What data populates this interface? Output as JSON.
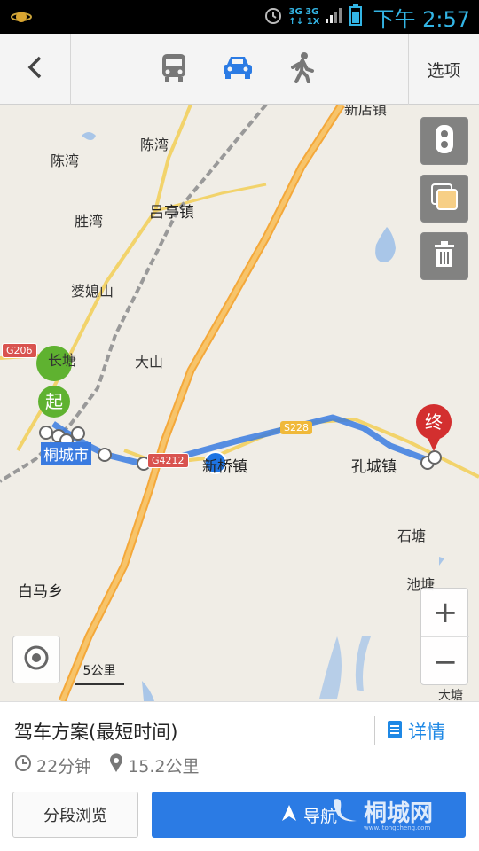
{
  "status_bar": {
    "network_top": "3G 3G",
    "network_bottom": "↑↓ 1X",
    "time": "下午 2:57",
    "accent": "#33b5e5"
  },
  "toolbar": {
    "back_icon": "chevron-left-icon",
    "modes": [
      {
        "name": "bus",
        "icon": "bus-icon",
        "active": false
      },
      {
        "name": "car",
        "icon": "car-icon",
        "active": true
      },
      {
        "name": "walk",
        "icon": "walk-icon",
        "active": false
      }
    ],
    "options_label": "选项",
    "active_color": "#2b7be4"
  },
  "map": {
    "places": [
      {
        "id": "chenwan-1",
        "label": "陈湾"
      },
      {
        "id": "chenwan-2",
        "label": "陈湾"
      },
      {
        "id": "lvting",
        "label": "吕亭镇"
      },
      {
        "id": "shengwan",
        "label": "胜湾"
      },
      {
        "id": "poxishan",
        "label": "婆媳山"
      },
      {
        "id": "changtang",
        "label": "长塘"
      },
      {
        "id": "dashan",
        "label": "大山"
      },
      {
        "id": "tongcheng",
        "label": "桐城市"
      },
      {
        "id": "xinqiao",
        "label": "新桥镇"
      },
      {
        "id": "kongcheng",
        "label": "孔城镇"
      },
      {
        "id": "shitang",
        "label": "石塘"
      },
      {
        "id": "chitang",
        "label": "池塘"
      },
      {
        "id": "baima",
        "label": "白马乡"
      },
      {
        "id": "datang",
        "label": "大塘"
      },
      {
        "id": "top-edge",
        "label": "新店镇"
      }
    ],
    "shields": [
      {
        "id": "g206",
        "label": "G206"
      },
      {
        "id": "g4212",
        "label": "G4212"
      },
      {
        "id": "s228",
        "label": "S228"
      }
    ],
    "start_marker": "起",
    "end_marker": "终",
    "scale_label": "5公里",
    "route_color": "#3a7be0",
    "start_color": "#5fb230",
    "end_color": "#d32f2f"
  },
  "map_controls": {
    "traffic_icon": "traffic-light-icon",
    "layers_icon": "layers-icon",
    "clear_icon": "trash-icon",
    "locate_icon": "locate-icon",
    "zoom_in": "+",
    "zoom_out": "−"
  },
  "route_panel": {
    "title": "驾车方案(最短时间)",
    "detail_label": "详情",
    "duration": "22分钟",
    "distance": "15.2公里",
    "segment_button": "分段浏览",
    "navigate_button": "导航",
    "watermark": "桐城网",
    "watermark_url": "www.itongcheng.com"
  }
}
